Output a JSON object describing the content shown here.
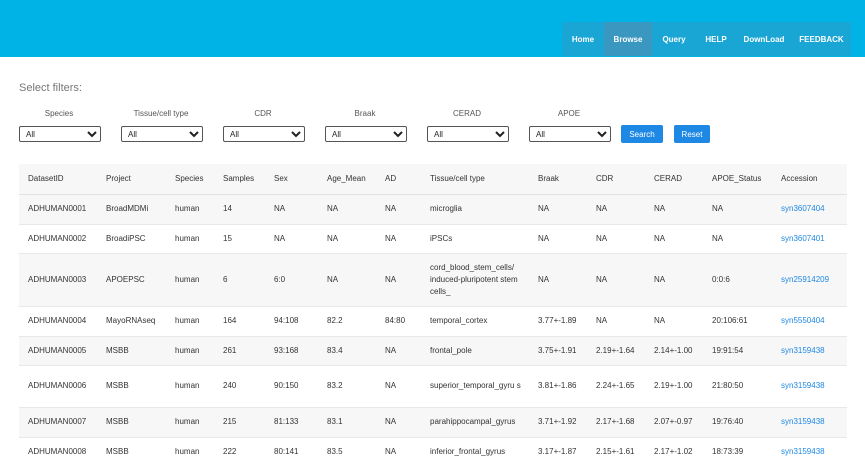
{
  "nav": [
    "Home",
    "Browse",
    "Query",
    "HELP",
    "DownLoad",
    "FEEDBACK"
  ],
  "filters": {
    "title": "Select filters:",
    "labels": [
      "Species",
      "Tissue/cell type",
      "CDR",
      "Braak",
      "CERAD",
      "APOE"
    ],
    "selected": [
      "All",
      "All",
      "All",
      "All",
      "All",
      "All"
    ],
    "search_label": "Search",
    "reset_label": "Reset"
  },
  "table": {
    "headers": [
      "DatasetID",
      "Project",
      "Species",
      "Samples",
      "Sex",
      "Age_Mean",
      "AD",
      "Tissue/cell type",
      "Braak",
      "CDR",
      "CERAD",
      "APOE_Status",
      "Accession"
    ],
    "rows": [
      [
        "ADHUMAN0001",
        "BroadMDMi",
        "human",
        "14",
        "NA",
        "NA",
        "NA",
        "microglia",
        "NA",
        "NA",
        "NA",
        "NA",
        "syn3607404"
      ],
      [
        "ADHUMAN0002",
        "BroadiPSC",
        "human",
        "15",
        "NA",
        "NA",
        "NA",
        "iPSCs",
        "NA",
        "NA",
        "NA",
        "NA",
        "syn3607401"
      ],
      [
        "ADHUMAN0003",
        "APOEPSC",
        "human",
        "6",
        "6:0",
        "NA",
        "NA",
        "cord_blood_stem_cells/ induced-pluripotent stem cells_",
        "NA",
        "NA",
        "NA",
        "0:0:6",
        "syn25914209"
      ],
      [
        "ADHUMAN0004",
        "MayoRNAseq",
        "human",
        "164",
        "94:108",
        "82.2",
        "84:80",
        "temporal_cortex",
        "3.77+-1.89",
        "NA",
        "NA",
        "20:106:61",
        "syn5550404"
      ],
      [
        "ADHUMAN0005",
        "MSBB",
        "human",
        "261",
        "93:168",
        "83.4",
        "NA",
        "frontal_pole",
        "3.75+-1.91",
        "2.19+-1.64",
        "2.14+-1.00",
        "19:91:54",
        "syn3159438"
      ],
      [
        "ADHUMAN0006",
        "MSBB",
        "human",
        "240",
        "90:150",
        "83.2",
        "NA",
        "superior_temporal_gyru s",
        "3.81+-1.86",
        "2.24+-1.65",
        "2.19+-1.00",
        "21:80:50",
        "syn3159438"
      ],
      [
        "ADHUMAN0007",
        "MSBB",
        "human",
        "215",
        "81:133",
        "83.1",
        "NA",
        "parahippocampal_gyrus",
        "3.71+-1.92",
        "2.17+-1.68",
        "2.07+-0.97",
        "19:76:40",
        "syn3159438"
      ],
      [
        "ADHUMAN0008",
        "MSBB",
        "human",
        "222",
        "80:141",
        "83.5",
        "NA",
        "inferior_frontal_gyrus",
        "3.17+-1.87",
        "2.15+-1.61",
        "2.17+-1.02",
        "18:73:39",
        "syn3159438"
      ]
    ]
  },
  "colors": {
    "header_bar": "#00b3e6",
    "nav_bg": "#1aa6d4",
    "nav_active": "#3a97bf",
    "button": "#1e88e5",
    "link": "#1e88e5"
  }
}
